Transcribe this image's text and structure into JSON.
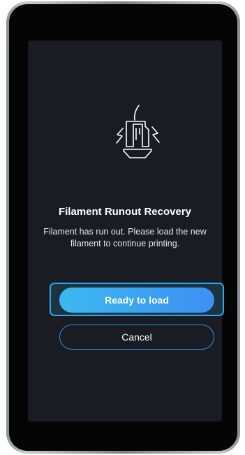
{
  "dialog": {
    "icon": "filament-runout-icon",
    "title": "Filament Runout Recovery",
    "message": "Filament has run out. Please load the new filament to continue printing.",
    "primary_label": "Ready to load",
    "cancel_label": "Cancel"
  },
  "colors": {
    "screen_background": "#1a1c23",
    "accent_start": "#3cb9f0",
    "accent_end": "#3d8ff5",
    "outline": "#2f8fe6"
  }
}
